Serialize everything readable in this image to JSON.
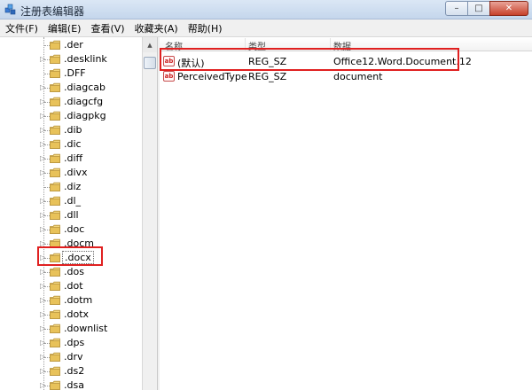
{
  "window": {
    "title": "注册表编辑器",
    "buttons": {
      "minimize": "–",
      "maximize": "□",
      "close": "✕"
    }
  },
  "menu": [
    "文件(F)",
    "编辑(E)",
    "查看(V)",
    "收藏夹(A)",
    "帮助(H)"
  ],
  "tree": {
    "items": [
      ".der",
      ".desklink",
      ".DFF",
      ".diagcab",
      ".diagcfg",
      ".diagpkg",
      ".dib",
      ".dic",
      ".diff",
      ".divx",
      ".diz",
      ".dl_",
      ".dll",
      ".doc",
      ".docm",
      ".docx",
      ".dos",
      ".dot",
      ".dotm",
      ".dotx",
      ".downlist",
      ".dps",
      ".drv",
      ".ds2",
      ".dsa"
    ],
    "selected": ".docx"
  },
  "list": {
    "headers": {
      "name": "名称",
      "type": "类型",
      "data": "数据"
    },
    "rows": [
      {
        "name": "(默认)",
        "type": "REG_SZ",
        "data": "Office12.Word.Document.12"
      },
      {
        "name": "PerceivedType",
        "type": "REG_SZ",
        "data": "document"
      }
    ]
  },
  "colors": {
    "highlight": "#e02020",
    "folder": "#e8c25a"
  }
}
